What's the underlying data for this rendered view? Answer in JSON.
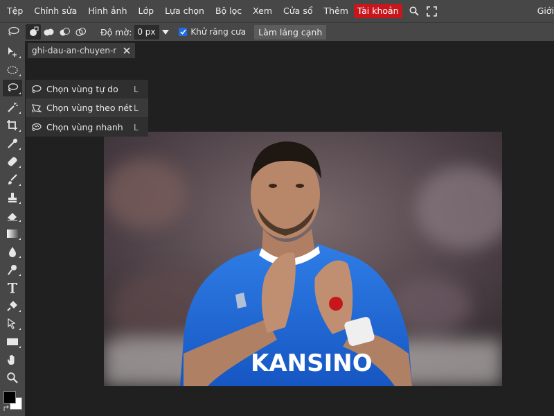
{
  "menubar": {
    "items": [
      "Tệp",
      "Chỉnh sửa",
      "Hình ảnh",
      "Lớp",
      "Lựa chọn",
      "Bộ lọc",
      "Xem",
      "Cửa sổ",
      "Thêm"
    ],
    "account_label": "Tài khoản",
    "right_label": "Giới",
    "account_color": "#c8161d",
    "icons": [
      "search-icon",
      "fullscreen-icon"
    ]
  },
  "options": {
    "feather_label": "Độ mờ:",
    "feather_value": "0 px",
    "antialias_label": "Khử răng cưa",
    "antialias_checked": true,
    "refine_label": "Làm láng cạnh"
  },
  "document": {
    "tab_label": "ghi-dau-an-chuyen-ng"
  },
  "flyout": {
    "items": [
      {
        "label": "Chọn vùng tự do",
        "key": "L",
        "icon": "lasso-icon"
      },
      {
        "label": "Chọn vùng theo nét",
        "key": "L",
        "icon": "polygon-lasso-icon"
      },
      {
        "label": "Chọn vùng nhanh",
        "key": "L",
        "icon": "magnetic-lasso-icon"
      }
    ]
  },
  "photo": {
    "jersey_text": "KANSINO"
  },
  "colors": {
    "foreground": "#000000",
    "background": "#ffffff",
    "accent": "#1e6de5"
  }
}
